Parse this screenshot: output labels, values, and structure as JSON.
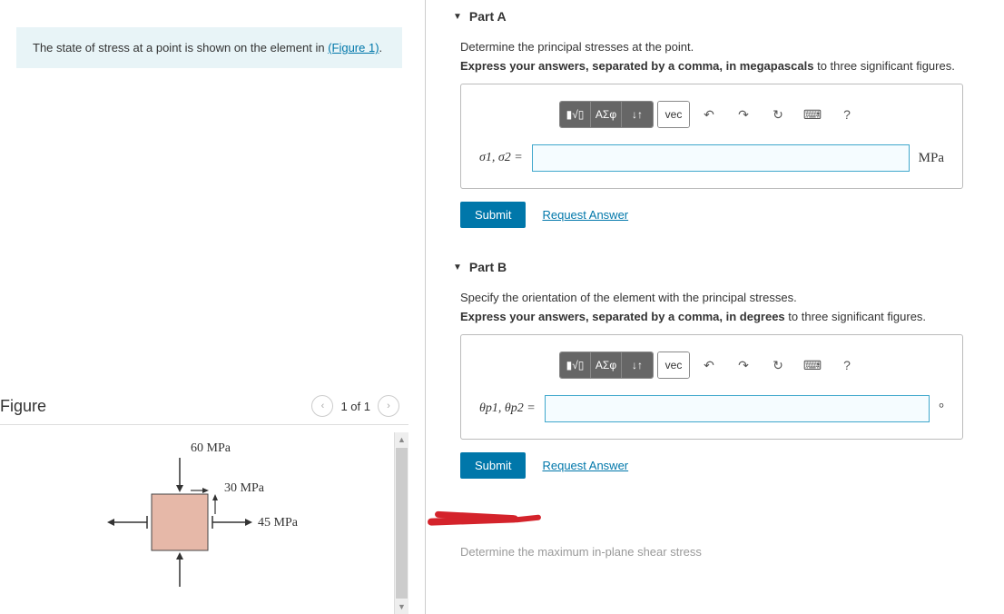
{
  "problem_text": "The state of stress at a point is shown on the element in ",
  "figure_link_text": "(Figure 1)",
  "problem_suffix": ".",
  "figure": {
    "title": "Figure",
    "page_indicator": "1 of 1",
    "labels": {
      "top": "60 MPa",
      "right_upper": "30 MPa",
      "right_lower": "45 MPa"
    }
  },
  "parts": [
    {
      "title": "Part A",
      "prompt": "Determine the principal stresses at the point.",
      "instructions_prefix": "Express your answers, separated by a comma, in megapascals",
      "instructions_suffix": " to three significant figures.",
      "var_label": "σ1, σ2 =",
      "unit": "MPa",
      "toolbar": {
        "greek": "ΑΣφ",
        "arrows": "↓↑",
        "vec": "vec"
      },
      "submit": "Submit",
      "request": "Request Answer"
    },
    {
      "title": "Part B",
      "prompt": "Specify the orientation of the element with the principal stresses.",
      "instructions_prefix": "Express your answers, separated by a comma, in degrees",
      "instructions_suffix": " to three significant figures.",
      "var_label": "θp1, θp2 =",
      "unit": "°",
      "toolbar": {
        "greek": "ΑΣφ",
        "arrows": "↓↑",
        "vec": "vec"
      },
      "submit": "Submit",
      "request": "Request Answer"
    }
  ],
  "cutoff_text": "Determine the maximum in-plane shear stress",
  "icons": {
    "help": "?",
    "keyboard": "⌨",
    "undo": "↶",
    "redo": "↷",
    "refresh": "↻",
    "template": "▮√▯"
  }
}
